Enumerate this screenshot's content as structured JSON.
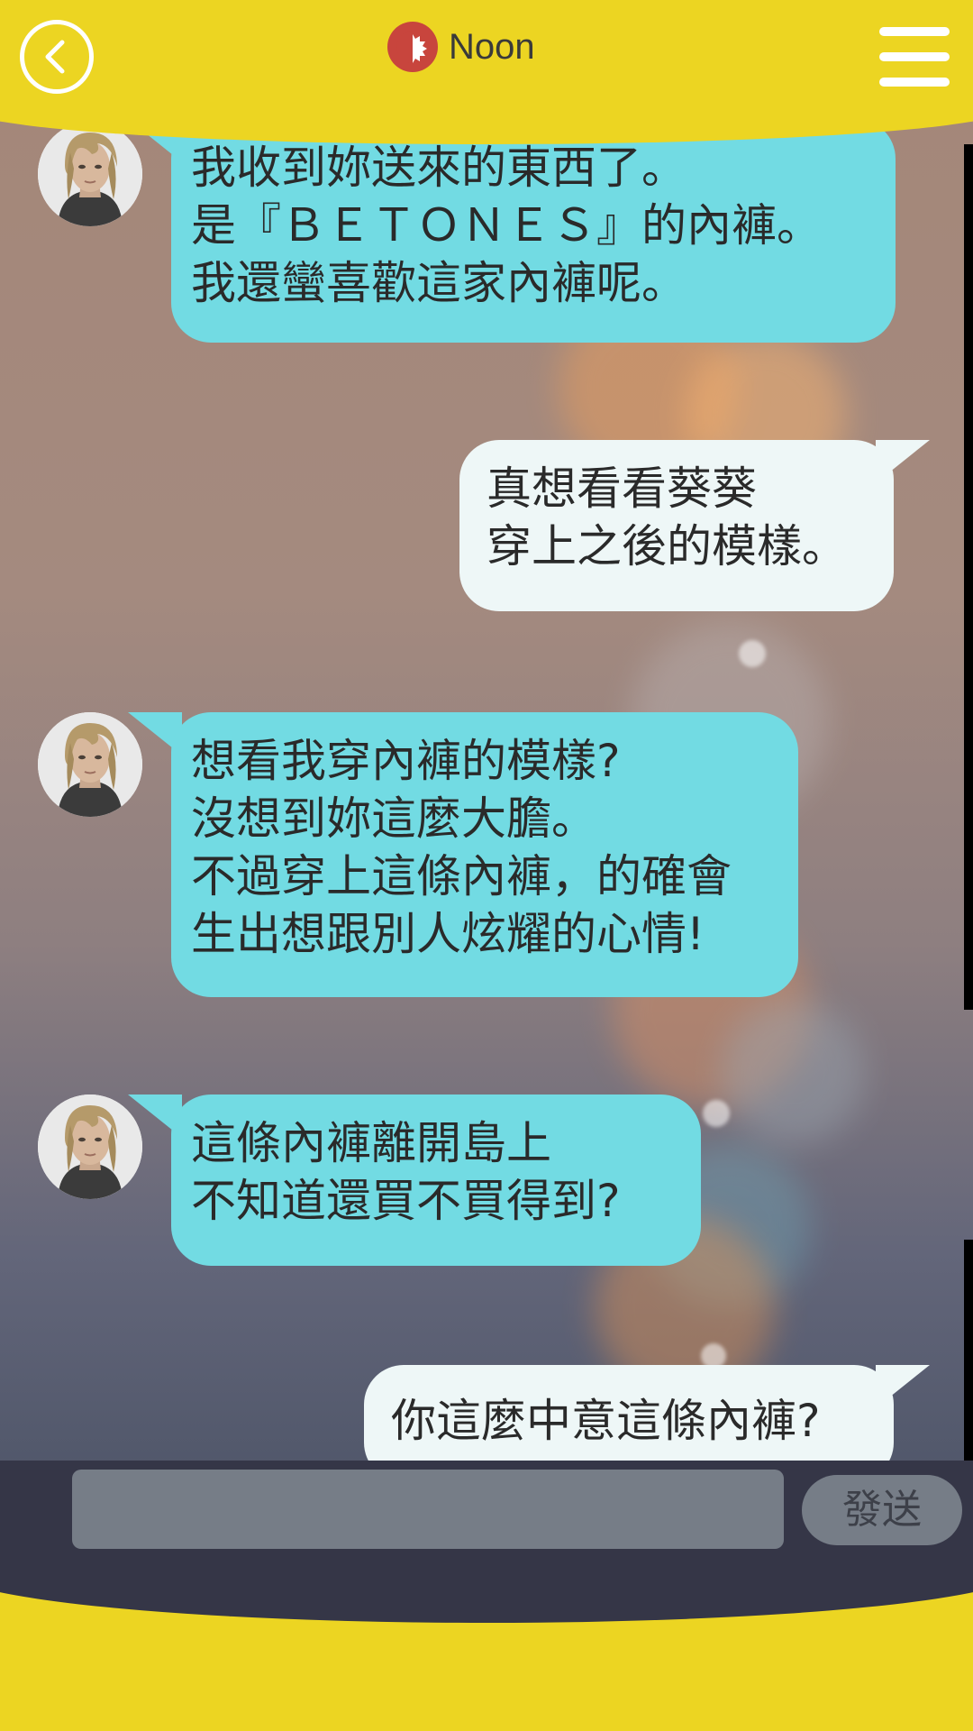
{
  "header": {
    "title": "Noon",
    "time_icon": "noon-sun-icon",
    "back_icon": "chevron-left-icon",
    "menu_icon": "hamburger-menu-icon"
  },
  "messages": [
    {
      "sender": "contact",
      "lines": [
        "我收到妳送來的東西了。",
        "是『ＢＥＴＯＮＥＳ』的內褲。",
        "我還蠻喜歡這家內褲呢。"
      ]
    },
    {
      "sender": "me",
      "lines": [
        "真想看看葵葵",
        "穿上之後的模樣。"
      ]
    },
    {
      "sender": "contact",
      "lines": [
        "想看我穿內褲的模樣?",
        "沒想到妳這麼大膽。",
        "不過穿上這條內褲，的確會",
        "生出想跟別人炫耀的心情!"
      ]
    },
    {
      "sender": "contact",
      "lines": [
        "這條內褲離開島上",
        "不知道還買不買得到?"
      ]
    },
    {
      "sender": "me",
      "lines": [
        "你這麼中意這條內褲?"
      ]
    }
  ],
  "input": {
    "value": "",
    "placeholder": ""
  },
  "send_button": {
    "label": "發送"
  },
  "colors": {
    "accent_yellow": "#ecd522",
    "incoming_bubble": "#72dbe3",
    "outgoing_bubble": "#eef7f7",
    "input_bar": "#353647",
    "noon_icon": "#c8453d"
  }
}
